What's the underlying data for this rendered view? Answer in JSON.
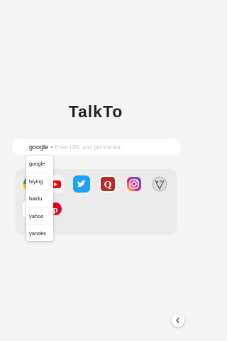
{
  "app": {
    "title": "TalkTo"
  },
  "search": {
    "engine": "google",
    "placeholder": "Enter URL and get started"
  },
  "engines": [
    "google",
    "biying",
    "baidu",
    "yahoo",
    "yandex"
  ],
  "shortcuts": [
    {
      "icon": "google-icon",
      "color": "#4285f4"
    },
    {
      "icon": "youtube-icon",
      "color": "#ff0000"
    },
    {
      "icon": "twitter-icon",
      "color": "#1da1f2"
    },
    {
      "icon": "quora-icon",
      "color": "#b92b27"
    },
    {
      "icon": "instagram-icon",
      "color": "#c13584"
    },
    {
      "icon": "wikipedia-icon",
      "color": "#777777"
    },
    {
      "icon": "yahoo-icon",
      "color": "#d60a0a"
    },
    {
      "icon": "pinterest-icon",
      "color": "#e60023"
    }
  ],
  "colors": {
    "background": "#f5f5f5",
    "panel": "#ebebeb"
  }
}
